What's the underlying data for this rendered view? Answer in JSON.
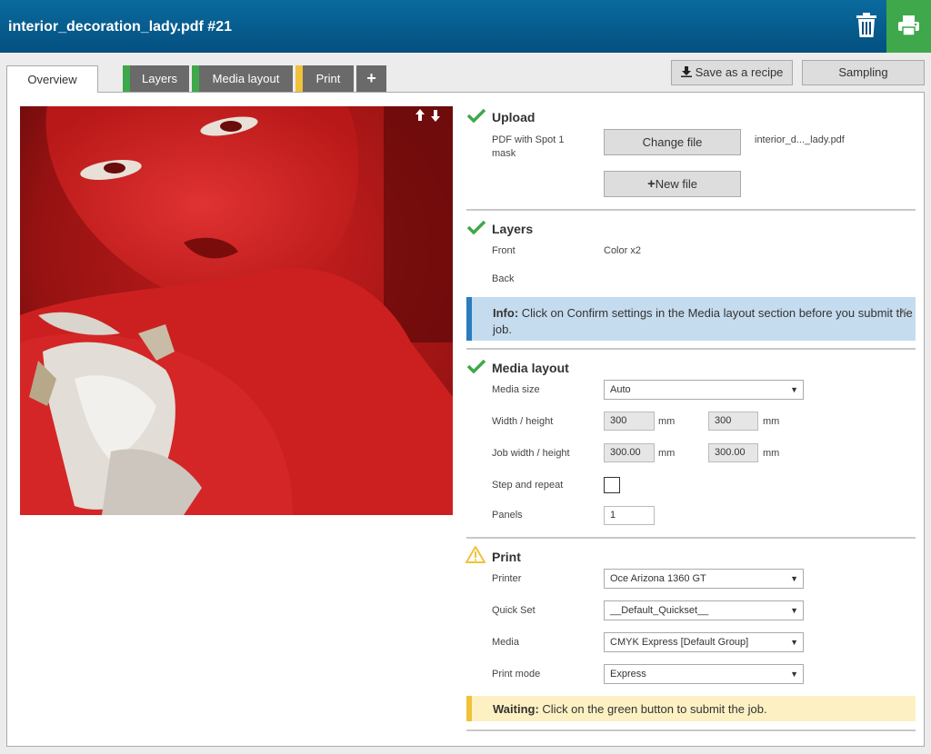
{
  "header": {
    "title": "interior_decoration_lady.pdf #21"
  },
  "tabs": {
    "overview": "Overview",
    "layers": "Layers",
    "media_layout": "Media layout",
    "print": "Print",
    "add": "+"
  },
  "toolbar": {
    "save_recipe": "Save as a recipe",
    "sampling": "Sampling"
  },
  "preview": {
    "arrows": "🡑🡓"
  },
  "upload": {
    "title": "Upload",
    "file_type": "PDF with Spot 1 mask",
    "change_file": "Change file",
    "file_name": "interior_d..._lady.pdf",
    "new_file": "New file"
  },
  "layers": {
    "title": "Layers",
    "front_label": "Front",
    "front_value": "Color x2",
    "back_label": "Back"
  },
  "info": {
    "strong": "Info:",
    "message": "Click on Confirm settings in the Media layout section before you submit the job.",
    "close": "×"
  },
  "media_layout": {
    "title": "Media layout",
    "media_size_label": "Media size",
    "media_size_value": "Auto",
    "width_height_label": "Width / height",
    "width": "300",
    "height": "300",
    "unit": "mm",
    "job_wh_label": "Job width / height",
    "job_width": "300.00",
    "job_height": "300.00",
    "step_repeat_label": "Step and repeat",
    "panels_label": "Panels",
    "panels_value": "1"
  },
  "print": {
    "title": "Print",
    "printer_label": "Printer",
    "printer_value": "Oce Arizona 1360 GT",
    "quickset_label": "Quick Set",
    "quickset_value": "__Default_Quickset__",
    "media_label": "Media",
    "media_value": "CMYK Express [Default Group]",
    "mode_label": "Print mode",
    "mode_value": "Express"
  },
  "waiting": {
    "strong": "Waiting:",
    "message": "Click on the green button to submit the job."
  },
  "colors": {
    "header": "#045080",
    "accent_green": "#3fa84a",
    "layers_stripe": "#3fa84a",
    "media_stripe": "#3fa84a",
    "print_stripe": "#f0c23a",
    "info": "#2a7bbf",
    "warning": "#f0c23a"
  },
  "icons": {
    "trash": "trash-icon",
    "printer": "printer-icon",
    "check": "check-icon",
    "warning": "warning-icon",
    "download": "download-icon",
    "plus": "plus-icon"
  }
}
